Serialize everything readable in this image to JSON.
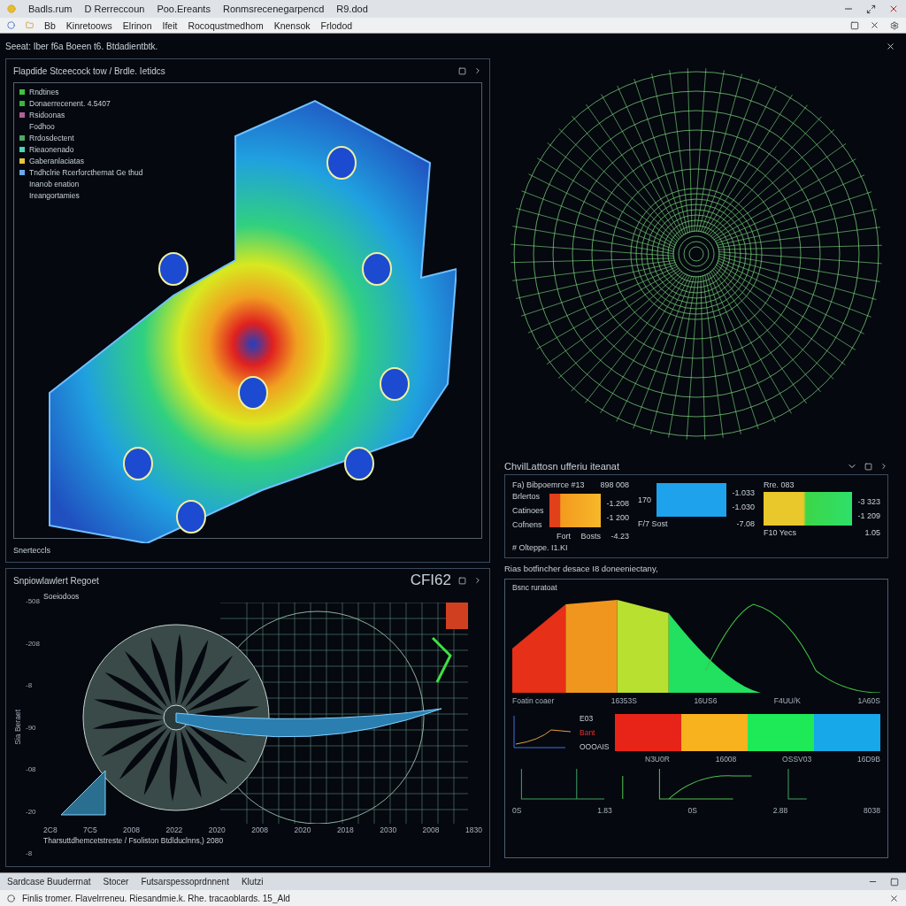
{
  "title_bar": {
    "items": [
      "Badls.rum",
      "D Rerreccoun",
      "Poo.Ereants",
      "Ronmsrecenegarpencd",
      "R9.dod"
    ]
  },
  "menu": {
    "items": [
      "Bb",
      "Kinretoows",
      "Elrinon",
      "Ifeit",
      "Rocoqustmedhom",
      "Knensok",
      "Frlodod"
    ]
  },
  "header": {
    "text": "Seeat: Iber f6a Boeen t6. Btdadientbtk."
  },
  "part_panel": {
    "title": "Flapdide Stceecock tow / Brdle. Ietidcs",
    "footer": "Snerteccls",
    "legend": [
      {
        "label": "Rndtines",
        "color": "#3ec43e"
      },
      {
        "label": "Donaerrecenent. 4.5407",
        "color": "#35b83a"
      },
      {
        "label": "Rsidoonas",
        "color": "#b0609a"
      },
      {
        "label": "Fodhoo"
      },
      {
        "label": "Rrdosdectent",
        "color": "#4caa60"
      },
      {
        "label": "Rieaonenado",
        "color": "#49d6b4"
      },
      {
        "label": "Gaberanlaciatas",
        "color": "#e6c63a"
      },
      {
        "label": "Tndhclrie Rcerforcthernat Ge thud",
        "color": "#6aa8f0"
      },
      {
        "label": "Inanob enation"
      },
      {
        "label": "Ireangortamies"
      }
    ]
  },
  "metrics_panel": {
    "title": "ChvilLattosn ufferiu iteanat",
    "meters": [
      {
        "heading": "Fa) Bibpoemrce #13",
        "reading": "898 008",
        "kind": "warm",
        "values": [
          "-1.208",
          "-1 200"
        ],
        "axis": [
          "Fort",
          "Bosts",
          "-4.23"
        ]
      },
      {
        "side": "170",
        "kind": "cool",
        "values": [
          "-1.033",
          "-1.030"
        ],
        "axis": [
          "F/7 Sost",
          "-7.08"
        ]
      },
      {
        "heading": "Rre. 083",
        "kind": "mixed",
        "values": [
          "-3 323",
          "-1 209"
        ],
        "axis": [
          "F10 Yecs",
          "1.05"
        ]
      }
    ],
    "row_labels": [
      "Brlertos",
      "Catinoes",
      "Cofnens"
    ],
    "note": "# Olteppe. I1.KI",
    "caption": "Rias botfincher desace I8 doneeniectany,",
    "chart_title": "Bsnc ruratoat",
    "chart_ticks": [
      "Foatin coaer",
      "16353S",
      "16US6",
      "F4UU/K",
      "1A60S"
    ],
    "strip_labels": [
      "N3U0R",
      "16008",
      "OSSV03",
      "16D9B"
    ],
    "curve_labels": [
      "E03",
      "Bant",
      "OOOAIS"
    ],
    "mini_labels": [
      "0S",
      "1.83",
      "0S",
      "2.88",
      "8038"
    ]
  },
  "turbine_panel": {
    "title": "Snpiowlawlert Regoet",
    "code": "CFI62",
    "ylabel": "Sia Beraet",
    "annotation": "Soeiodoos",
    "yticks": [
      "-508",
      "-208",
      "-8",
      "-90",
      "-08",
      "-20",
      "-8"
    ],
    "xticks": [
      "2C8",
      "7C5",
      "2008",
      "2022",
      "2020",
      "2008",
      "2020",
      "2018",
      "2030",
      "2008",
      "1830"
    ],
    "caption": "Tharsuttdhemcetstreste / Fsoliston Btdlduclnns,) 2080"
  },
  "bottom_tabs": [
    "Sardcase Buuderrnat",
    "Stocer",
    "Futsarspessoprdnnent",
    "Klutzi"
  ],
  "status_bar": {
    "text": "Finlis tromer. Flavelrreneu. Riesandmie.k. Rhe. tracaoblards. 15_Ald"
  }
}
